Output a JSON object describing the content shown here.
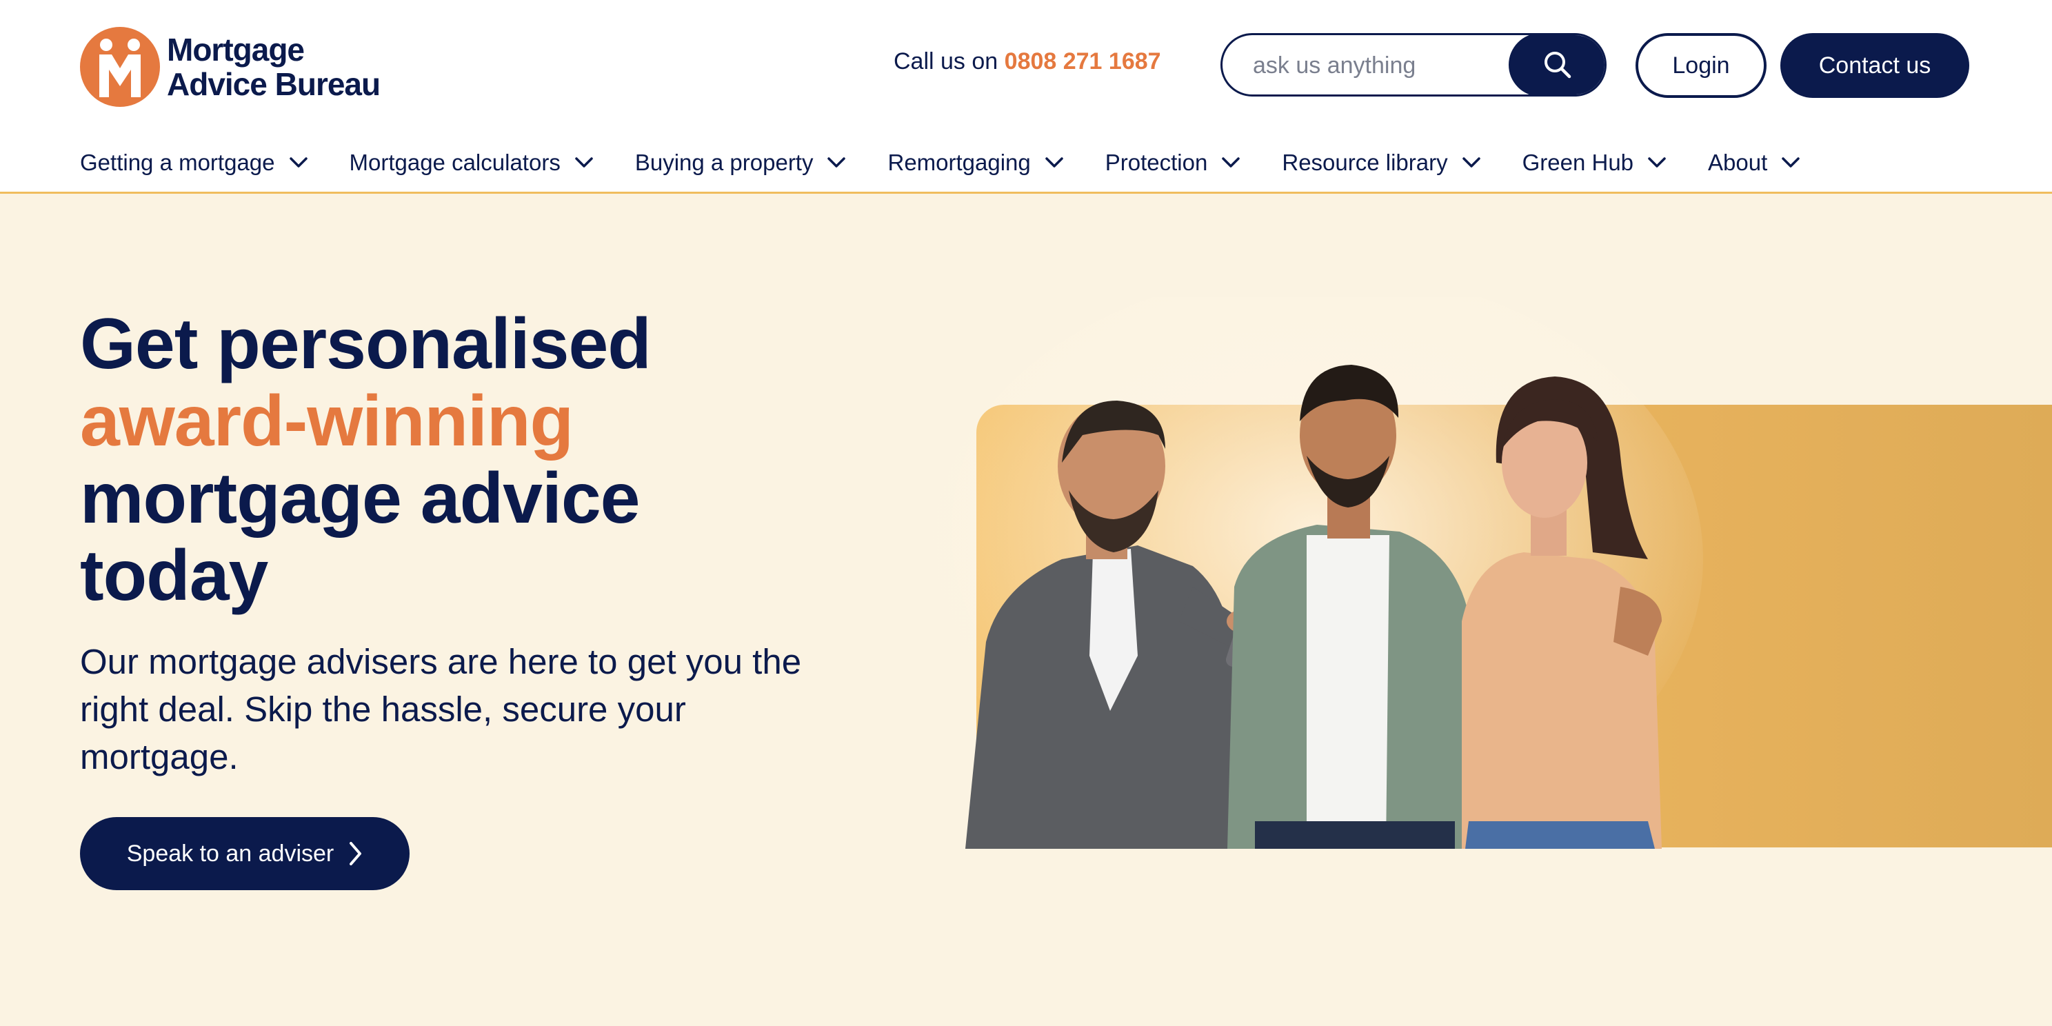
{
  "brand": {
    "name_line1": "Mortgage",
    "name_line2": "Advice Bureau",
    "logo_color": "#e5793f",
    "navy": "#0b1a4c"
  },
  "header": {
    "call_prefix": "Call us on",
    "phone": "0808 271 1687",
    "search": {
      "placeholder": "ask us anything",
      "value": ""
    },
    "login_label": "Login",
    "contact_label": "Contact us"
  },
  "nav": {
    "items": [
      {
        "label": "Getting a mortgage"
      },
      {
        "label": "Mortgage calculators"
      },
      {
        "label": "Buying a property"
      },
      {
        "label": "Remortgaging"
      },
      {
        "label": "Protection"
      },
      {
        "label": "Resource library"
      },
      {
        "label": "Green Hub"
      },
      {
        "label": "About"
      }
    ]
  },
  "hero": {
    "headline_line1": "Get personalised",
    "headline_accent": "award-winning",
    "headline_line3": "mortgage advice",
    "headline_line4": "today",
    "subtext": "Our mortgage advisers are here to get you the right deal. Skip the hassle, secure your mortgage.",
    "cta_label": "Speak to an adviser",
    "background": "#fbf3e2",
    "panel_color": "#ebb55f"
  },
  "icons": {
    "search": "search-icon",
    "chevron": "chevron-down-icon",
    "cta_arrow": "chevron-right-icon"
  }
}
